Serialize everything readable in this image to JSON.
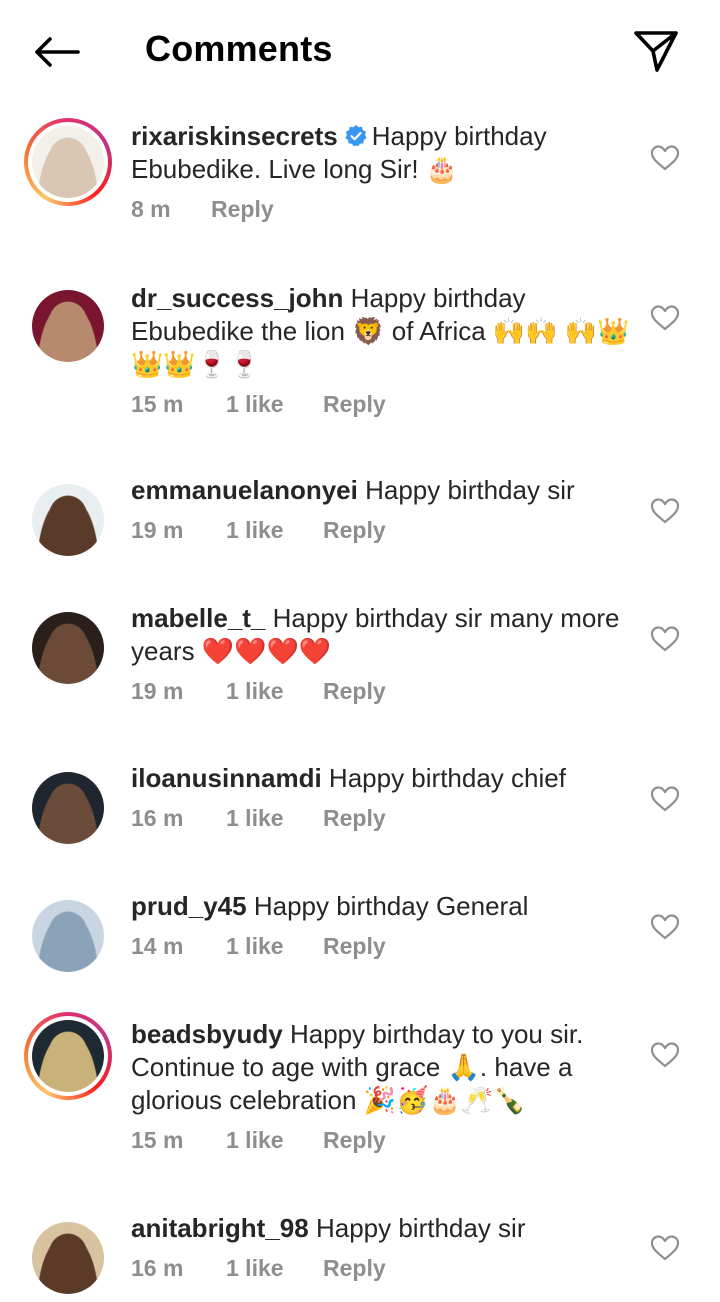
{
  "header": {
    "title": "Comments"
  },
  "comments": [
    {
      "username": "rixariskinsecrets",
      "verified": true,
      "story_ring": true,
      "text": "Happy birthday Ebubedike. Live long Sir! 🎂",
      "time": "8 m",
      "likes": "",
      "reply": "Reply",
      "avatar_colors": [
        "#f3efe9",
        "#d9c7b4"
      ]
    },
    {
      "username": "dr_success_john",
      "verified": false,
      "story_ring": false,
      "text": "Happy birthday Ebubedike the lion 🦁 of Africa 🙌🙌 🙌👑👑👑🍷🍷",
      "time": "15 m",
      "likes": "1 like",
      "reply": "Reply",
      "avatar_colors": [
        "#7a1530",
        "#b78a6e"
      ]
    },
    {
      "username": "emmanuelanonyei",
      "verified": false,
      "story_ring": false,
      "text": "Happy birthday sir",
      "time": "19 m",
      "likes": "1 like",
      "reply": "Reply",
      "avatar_colors": [
        "#e9eef0",
        "#5a3a28"
      ]
    },
    {
      "username": "mabelle_t_",
      "verified": false,
      "story_ring": false,
      "text": "Happy birthday sir many more years ❤️❤️❤️❤️",
      "time": "19 m",
      "likes": "1 like",
      "reply": "Reply",
      "avatar_colors": [
        "#2a1f1a",
        "#6b4a38"
      ]
    },
    {
      "username": "iloanusinnamdi",
      "verified": false,
      "story_ring": false,
      "text": "Happy birthday chief",
      "time": "16 m",
      "likes": "1 like",
      "reply": "Reply",
      "avatar_colors": [
        "#1f2630",
        "#6b4b3a"
      ]
    },
    {
      "username": "prud_y45",
      "verified": false,
      "story_ring": false,
      "text": "Happy birthday General",
      "time": "14 m",
      "likes": "1 like",
      "reply": "Reply",
      "avatar_colors": [
        "#c9d6e2",
        "#8aa3b8"
      ]
    },
    {
      "username": "beadsbyudy",
      "verified": false,
      "story_ring": true,
      "text": "Happy birthday to you sir. Continue to age with grace 🙏. have a glorious celebration 🎉🥳🎂🥂🍾",
      "time": "15 m",
      "likes": "1 like",
      "reply": "Reply",
      "avatar_colors": [
        "#1e2a33",
        "#c8b27a"
      ]
    },
    {
      "username": "anitabright_98",
      "verified": false,
      "story_ring": false,
      "text": "Happy birthday sir",
      "time": "16 m",
      "likes": "1 like",
      "reply": "Reply",
      "avatar_colors": [
        "#d8c3a0",
        "#5b3a28"
      ]
    }
  ]
}
